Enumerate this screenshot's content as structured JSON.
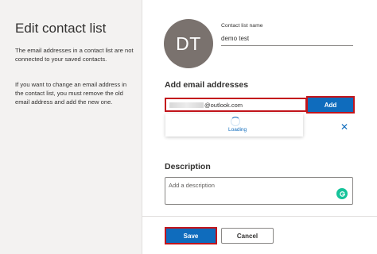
{
  "sidebar": {
    "title": "Edit contact list",
    "paragraph_1": "The email addresses in a contact list are not connected to your saved contacts.",
    "paragraph_2": "If you want to change an email address in the contact list, you must remove the old email address and add the new one."
  },
  "contact_list": {
    "avatar_initials": "DT",
    "name_label": "Contact list name",
    "name_value": "demo test"
  },
  "add_email": {
    "heading": "Add email addresses",
    "input_value": "@outlook.com",
    "add_label": "Add",
    "loading_text": "Loading"
  },
  "description": {
    "heading": "Description",
    "placeholder": "Add a description"
  },
  "footer": {
    "save_label": "Save",
    "cancel_label": "Cancel"
  },
  "colors": {
    "primary": "#0f6cbd",
    "highlight_border": "#c3151c",
    "avatar": "#7a726e",
    "grammarly": "#15c39a",
    "sidebar_bg": "#f3f2f1"
  },
  "icons": {
    "remove": "close-icon",
    "loading": "spinner-icon",
    "grammarly": "grammarly-icon"
  }
}
